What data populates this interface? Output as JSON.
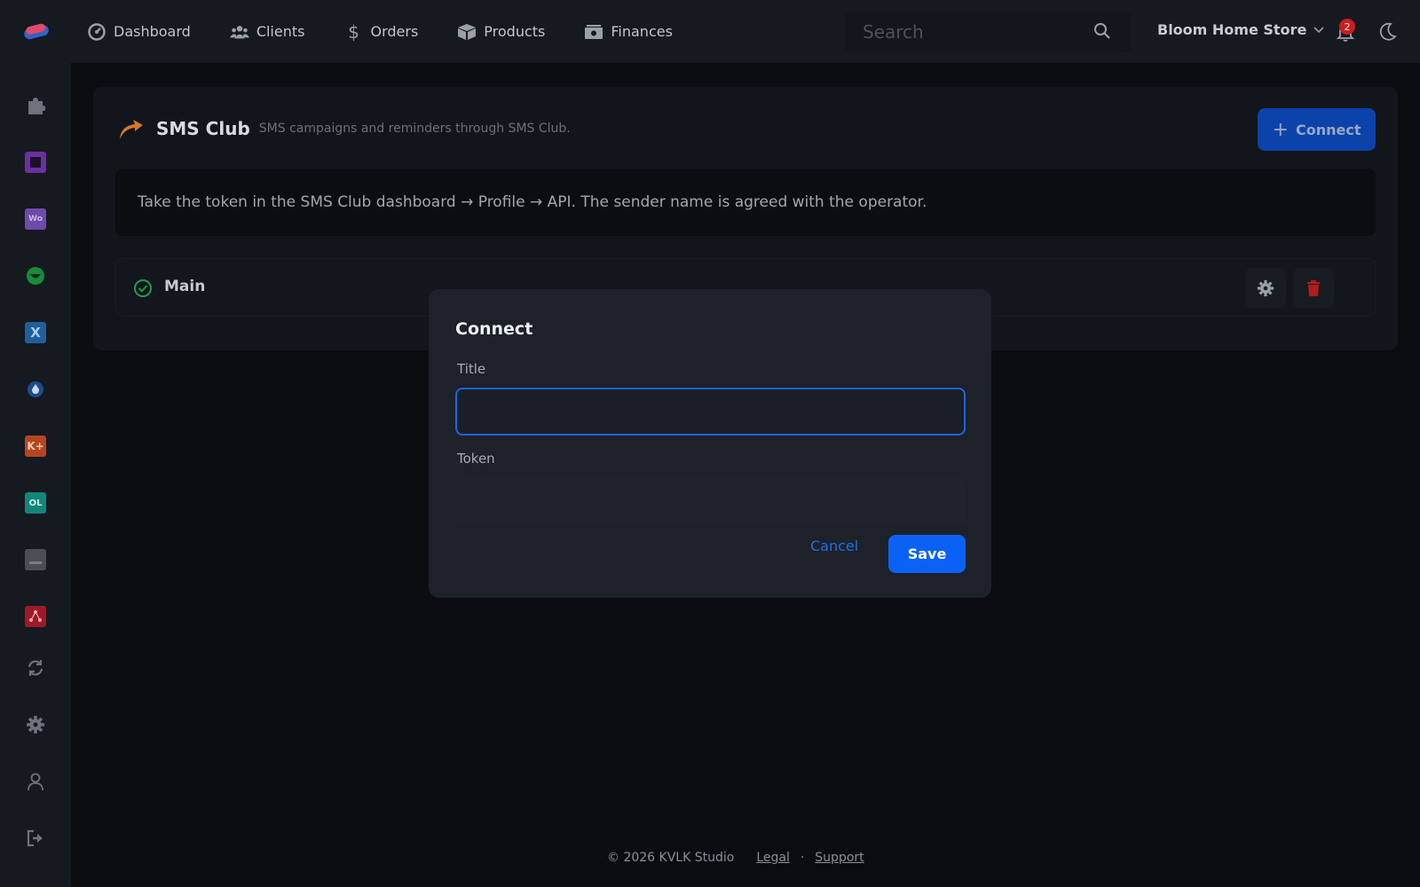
{
  "nav": {
    "items": [
      {
        "label": "Dashboard",
        "icon": "dashboard-icon"
      },
      {
        "label": "Clients",
        "icon": "users-icon"
      },
      {
        "label": "Orders",
        "icon": "dollar-icon"
      },
      {
        "label": "Products",
        "icon": "box-icon"
      },
      {
        "label": "Finances",
        "icon": "money-icon"
      }
    ]
  },
  "search": {
    "placeholder": "Search"
  },
  "store": {
    "name": "Bloom Home Store"
  },
  "notifications": {
    "count": "2"
  },
  "sidebar": {
    "items": [
      "puzzle-icon",
      "square-icon",
      "woo-icon",
      "smile-icon",
      "x-icon",
      "drop-icon",
      "k-icon",
      "ol-icon",
      "card-icon",
      "network-icon",
      "refresh-icon",
      "gear-icon",
      "user-icon",
      "logout-icon"
    ]
  },
  "integration": {
    "title": "SMS Club",
    "subtitle": "SMS campaigns and reminders through SMS Club.",
    "connect_label": "Connect",
    "info": "Take the token in the SMS Club dashboard → Profile → API. The sender name is agreed with the operator.",
    "connections": [
      {
        "label": "Main",
        "status": "active"
      }
    ]
  },
  "modal": {
    "title": "Connect",
    "title_label": "Title",
    "title_value": "",
    "token_label": "Token",
    "token_value": "",
    "cancel_label": "Cancel",
    "save_label": "Save"
  },
  "footer": {
    "copyright": "© 2026 KVLK Studio",
    "legal": "Legal",
    "separator": "·",
    "support": "Support"
  },
  "colors": {
    "accent": "#0a62f5",
    "danger": "#c81e1e",
    "success": "#1f9a54",
    "brand_orange": "#d9762b"
  }
}
